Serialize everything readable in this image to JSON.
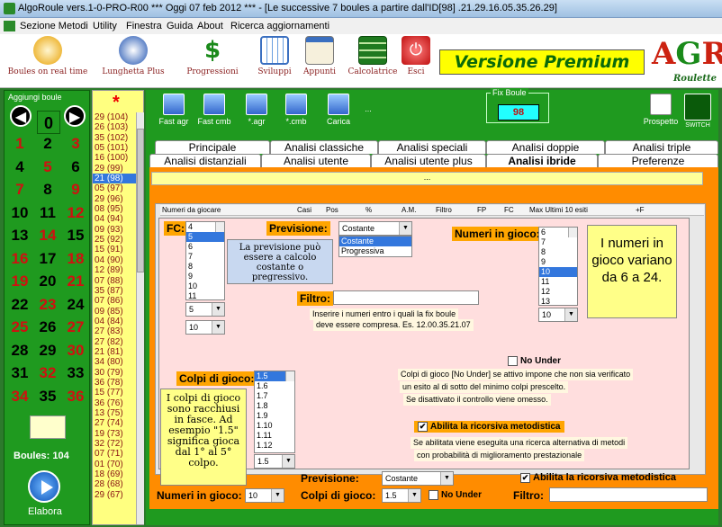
{
  "window": {
    "title": "AlgoRoule vers.1-0-PRO-R00  ***  Oggi 07 feb 2012  ***   - [Le successive 7 boules a partire dall'ID[98] .21.29.16.05.35.26.29]"
  },
  "menu": [
    "Sezione Metodi",
    "Utility",
    "Finestra",
    "Guida",
    "About",
    "Ricerca aggiornamenti"
  ],
  "toolbar": [
    {
      "label": "Boules on real time",
      "icon": "clock-icon"
    },
    {
      "label": "Lunghetta Plus",
      "icon": "lottery-icon"
    },
    {
      "label": "Progressioni",
      "icon": "dollar-icon"
    },
    {
      "label": "Sviluppi",
      "icon": "calendar-grid-icon"
    },
    {
      "label": "Appunti",
      "icon": "notepad-icon"
    },
    {
      "label": "Calcolatrice",
      "icon": "calculator-icon"
    },
    {
      "label": "Esci",
      "icon": "power-icon"
    }
  ],
  "premium": "Versione Premium",
  "logo": {
    "big": "AGR",
    "small": "Roulette"
  },
  "left": {
    "title": "Aggiungi boule",
    "zero": "0",
    "boules": "Boules: 104",
    "elabora": "Elabora",
    "numbers": [
      [
        "1",
        "2",
        "3"
      ],
      [
        "4",
        "5",
        "6"
      ],
      [
        "7",
        "8",
        "9"
      ],
      [
        "10",
        "11",
        "12"
      ],
      [
        "13",
        "14",
        "15"
      ],
      [
        "16",
        "17",
        "18"
      ],
      [
        "19",
        "20",
        "21"
      ],
      [
        "22",
        "23",
        "24"
      ],
      [
        "25",
        "26",
        "27"
      ],
      [
        "28",
        "29",
        "30"
      ],
      [
        "31",
        "32",
        "33"
      ],
      [
        "34",
        "35",
        "36"
      ]
    ],
    "colors": [
      [
        "r",
        "b",
        "r"
      ],
      [
        "b",
        "r",
        "b"
      ],
      [
        "r",
        "b",
        "r"
      ],
      [
        "b",
        "b",
        "r"
      ],
      [
        "b",
        "r",
        "b"
      ],
      [
        "r",
        "b",
        "r"
      ],
      [
        "r",
        "b",
        "r"
      ],
      [
        "b",
        "r",
        "b"
      ],
      [
        "r",
        "b",
        "r"
      ],
      [
        "b",
        "b",
        "r"
      ],
      [
        "b",
        "r",
        "b"
      ],
      [
        "r",
        "b",
        "r"
      ]
    ]
  },
  "history": {
    "star": "*",
    "items": [
      "29 (104)",
      "26 (103)",
      "35 (102)",
      "05 (101)",
      "16 (100)",
      "29 (99)",
      "21 (98)",
      "05 (97)",
      "29 (96)",
      "08 (95)",
      "04 (94)",
      "09 (93)",
      "25 (92)",
      "15 (91)",
      "04 (90)",
      "12 (89)",
      "07 (88)",
      "35 (87)",
      "07 (86)",
      "09 (85)",
      "04 (84)",
      "27 (83)",
      "27 (82)",
      "21 (81)",
      "34 (80)",
      "30 (79)",
      "36 (78)",
      "15 (77)",
      "36 (76)",
      "13 (75)",
      "27 (74)",
      "19 (73)",
      "32 (72)",
      "07 (71)",
      "01 (70)",
      "18 (69)",
      "28 (68)",
      "29 (67)"
    ],
    "selected": 6
  },
  "icons": [
    {
      "label": "Fast agr"
    },
    {
      "label": "Fast cmb"
    },
    {
      "label": "*.agr"
    },
    {
      "label": "*.cmb"
    },
    {
      "label": "Carica"
    },
    {
      "label": "..."
    }
  ],
  "fixboule": {
    "label": "Fix Boule",
    "value": "98"
  },
  "prospetto": "Prospetto",
  "switch": "SWITCH",
  "tabs_row1": [
    "Principale",
    "Analisi classiche",
    "Analisi speciali",
    "Analisi doppie",
    "Analisi triple"
  ],
  "tabs_row2": [
    "Analisi distanziali",
    "Analisi utente",
    "Analisi utente plus",
    "Analisi ibride",
    "Preferenze"
  ],
  "yellowbar": "...",
  "columns": [
    "Numeri da giocare",
    "Casi",
    "Pos",
    "%",
    "A.M.",
    "Filtro",
    "FP",
    "FC",
    "Max Ultimi 10 esiti",
    "+F"
  ],
  "fc": {
    "label": "FC:",
    "items": [
      "4",
      "5",
      "6",
      "7",
      "8",
      "9",
      "10",
      "11"
    ],
    "selected": 1,
    "combo1": "5",
    "combo2": "10"
  },
  "previsione": {
    "label": "Previsione:",
    "value": "Costante",
    "options": [
      "Costante",
      "Progressiva"
    ]
  },
  "tip_previsione": "La previsione può essere a calcolo costante o pregressivo.",
  "numeri": {
    "label": "Numeri in gioco:",
    "items": [
      "6",
      "7",
      "8",
      "9",
      "10",
      "11",
      "12",
      "13"
    ],
    "selected": 4,
    "combo": "10"
  },
  "tip_numeri": "I numeri in gioco variano da 6 a 24.",
  "filtro": {
    "label": "Filtro:",
    "value": "",
    "note1": "Inserire i numeri entro i quali la fix boule",
    "note2": "deve essere compresa. Es. 12.00.35.21.07"
  },
  "nounder": {
    "label": "No Under",
    "note1": "Colpi di gioco [No Under] se attivo impone che non sia verificato",
    "note2": "un esito al di sotto del minimo colpi prescelto.",
    "note3": "Se disattivato il controllo viene omesso."
  },
  "ricorsiva": {
    "label": "Abilita la ricorsiva metodistica",
    "note1": "Se abilitata viene eseguita una ricerca alternativa di metodi",
    "note2": "con probabilità di miglioramento prestazionale"
  },
  "colpi": {
    "label": "Colpi di gioco:",
    "items": [
      "1.5",
      "1.6",
      "1.7",
      "1.8",
      "1.9",
      "1.10",
      "1.11",
      "1.12"
    ],
    "combo": "1.5"
  },
  "tip_colpi": "I colpi di gioco sono racchiusi in fasce. Ad esempio \"1.5\" significa gioca dal 1° al 5° colpo.",
  "bottom": {
    "previsione_label": "Previsione:",
    "previsione_value": "Costante",
    "ricorsiva": "Abilita la ricorsiva metodistica",
    "numeri_label": "Numeri in gioco:",
    "numeri_value": "10",
    "colpi_label": "Colpi di gioco:",
    "colpi_value": "1.5",
    "nounder": "No Under",
    "filtro_label": "Filtro:"
  }
}
